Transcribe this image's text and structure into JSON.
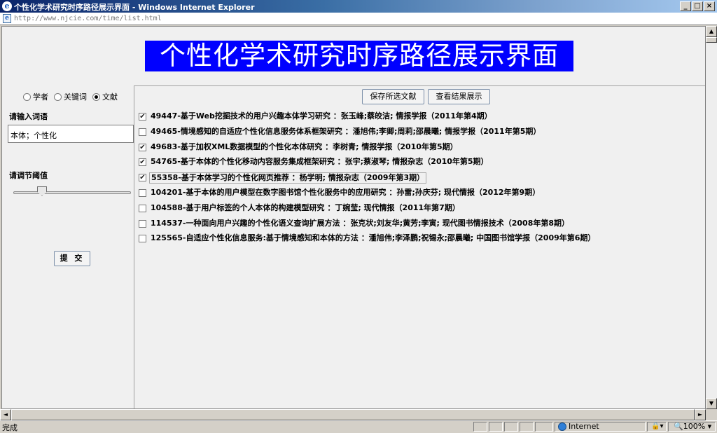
{
  "window": {
    "title": "个性化学术研究时序路径展示界面 - Windows Internet Explorer",
    "url": "http://www.njcie.com/time/list.html",
    "controls": {
      "minimize": "_",
      "maximize": "□",
      "close": "×"
    }
  },
  "page": {
    "banner": "个性化学术研究时序路径展示界面"
  },
  "left_panel": {
    "search_types": [
      {
        "label": "学者",
        "checked": false
      },
      {
        "label": "关键词",
        "checked": false
      },
      {
        "label": "文献",
        "checked": true
      }
    ],
    "term_label": "请输入词语",
    "term_value": "本体；个性化",
    "threshold_label": "请调节阈值",
    "threshold_fraction": 0.22,
    "submit_label": "提 交"
  },
  "right_panel": {
    "save_label": "保存所选文献",
    "view_label": "查看结果展示",
    "documents": [
      {
        "text": "49447-基于Web挖掘技术的用户兴趣本体学习研究 ：张玉峰;蔡皎洁; 情报学报（2011年第4期）",
        "checked": true
      },
      {
        "text": "49465-情境感知的自适应个性化信息服务体系框架研究 ：潘旭伟;李卿;周莉;邵晨曦; 情报学报（2011年第5期）",
        "checked": false
      },
      {
        "text": "49683-基于加权XML数据模型的个性化本体研究 ：李树青; 情报学报（2010年第5期）",
        "checked": true
      },
      {
        "text": "54765-基于本体的个性化移动内容服务集成框架研究 ：张宇;蔡淑琴; 情报杂志（2010年第5期）",
        "checked": true
      },
      {
        "text": "55358-基于本体学习的个性化网页推荐 ：杨学明; 情报杂志（2009年第3期）",
        "checked": true
      },
      {
        "text": "104201-基于本体的用户模型在数字图书馆个性化服务中的应用研究 ：孙雷;孙庆芬; 现代情报（2012年第9期）",
        "checked": false
      },
      {
        "text": "104588-基于用户标签的个人本体的构建模型研究 ：丁婉莹; 现代情报（2011年第7期）",
        "checked": false
      },
      {
        "text": "114537-一种面向用户兴趣的个性化语义查询扩展方法 ：张克状;刘友华;黄芳;李寅; 现代图书情报技术（2008年第8期）",
        "checked": false
      },
      {
        "text": "125565-自适应个性化信息服务:基于情境感知和本体的方法 ：潘旭伟;李泽鹏;祝锡永;邵晨曦; 中国图书馆学报（2009年第6期）",
        "checked": false
      }
    ]
  },
  "statusbar": {
    "status": "完成",
    "zone": "Internet",
    "zoom": "100%"
  },
  "icons": {
    "ie": "ie-logo-icon",
    "page": "page-icon",
    "globe": "globe-icon",
    "lock": "lock-icon"
  }
}
